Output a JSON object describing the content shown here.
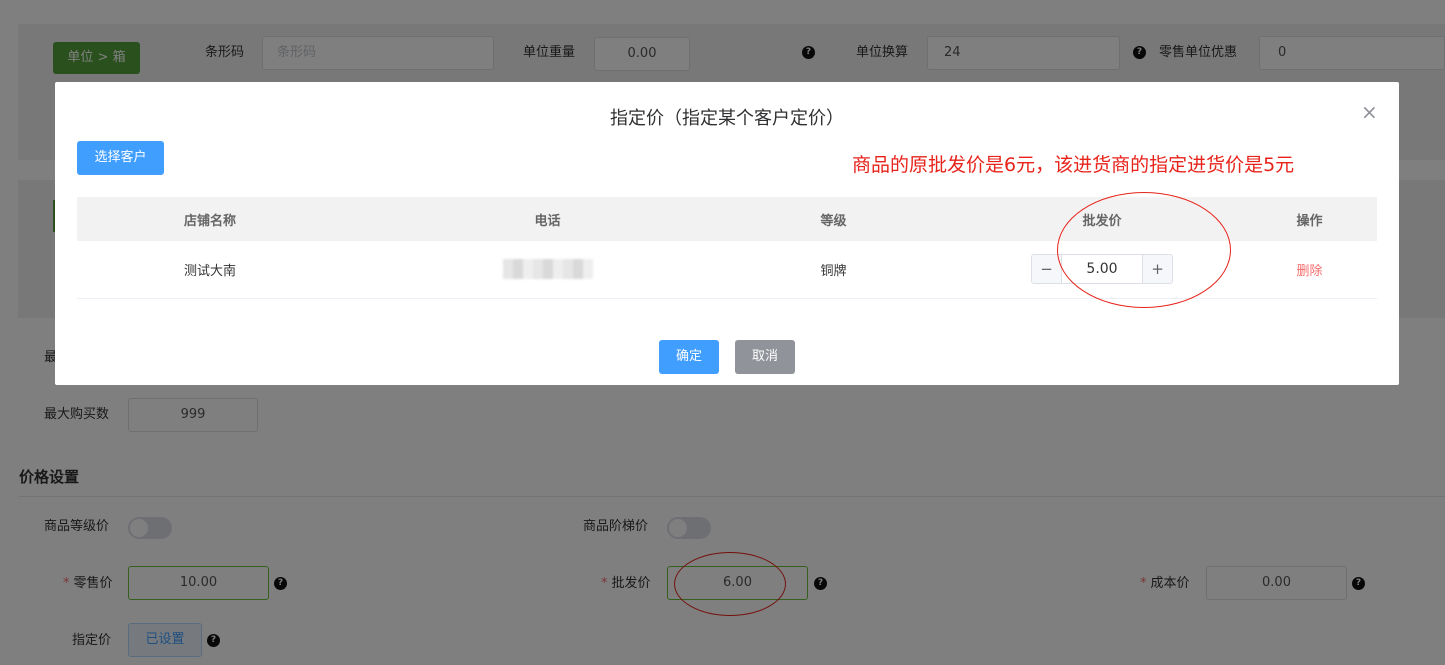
{
  "background_form": {
    "unit_button": "单位 > 箱",
    "barcode_label": "条形码",
    "barcode_placeholder": "条形码",
    "unit_weight_label": "单位重量",
    "unit_weight_value": "0.00",
    "unit_conversion_label": "单位换算",
    "unit_conversion_value": "24",
    "retail_unit_discount_label": "零售单位优惠",
    "retail_unit_discount_value": "0",
    "min_purchase_label_partial": "最",
    "max_purchase_label": "最大购买数",
    "max_purchase_value": "999",
    "help_icon_glyph": "?"
  },
  "price_settings": {
    "section_title": "价格设置",
    "level_price_label": "商品等级价",
    "tier_price_label": "商品阶梯价",
    "required_mark": "*",
    "retail_price_label": "零售价",
    "retail_price_value": "10.00",
    "wholesale_price_label": "批发价",
    "wholesale_price_value": "6.00",
    "cost_price_label": "成本价",
    "cost_price_value": "0.00",
    "designated_price_label": "指定价",
    "designated_price_button": "已设置"
  },
  "dialog": {
    "title": "指定价（指定某个客户定价）",
    "close_glyph": "×",
    "select_customer_button": "选择客户",
    "annotation": "商品的原批发价是6元，该进货商的指定进货价是5元",
    "annotation_color": "#e8231b",
    "table": {
      "headers": [
        "店铺名称",
        "电话",
        "等级",
        "批发价",
        "操作"
      ],
      "rows": [
        {
          "store_name": "测试大南",
          "phone": "",
          "level": "铜牌",
          "price": "5.00",
          "action": "删除"
        }
      ]
    },
    "stepper_minus": "−",
    "stepper_plus": "+",
    "confirm_button": "确定",
    "cancel_button": "取消"
  },
  "colors": {
    "primary": "#409eff",
    "green": "#52a13a",
    "danger": "#f56c6c"
  }
}
